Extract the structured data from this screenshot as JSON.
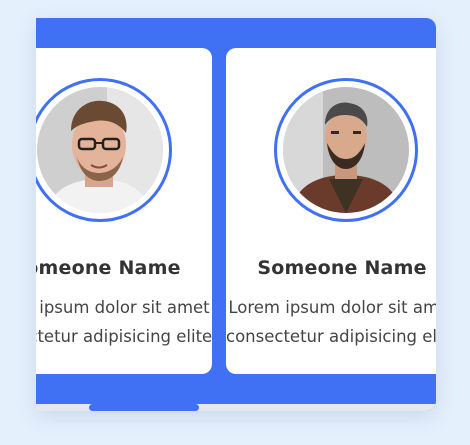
{
  "cards": [
    {
      "name": "Someone Name",
      "description_line1": "Lorem ipsum dolor sit amet",
      "description_line2": "consectetur adipisicing elite."
    },
    {
      "name": "Someone Name",
      "description_line1": "Lorem ipsum dolor sit amet",
      "description_line2": "consectetur adipisicing elite."
    }
  ],
  "colors": {
    "page_background": "#e4f0fc",
    "accent": "#4070f4",
    "card_background": "#ffffff",
    "name_text": "#333333",
    "description_text": "#444444",
    "scrollbar_track": "#e4e7ee"
  },
  "icons": {
    "card1_image": "avatar-photo-man-glasses",
    "card2_image": "avatar-photo-man-beard-jacket"
  }
}
